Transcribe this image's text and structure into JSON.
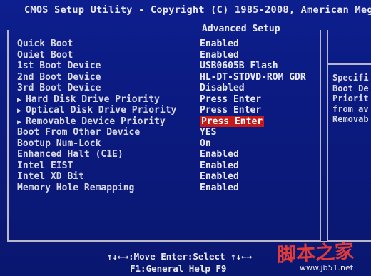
{
  "header": {
    "title": "CMOS Setup Utility - Copyright (C) 1985-2008, American Meg",
    "subtitle": "Advanced Setup"
  },
  "settings": [
    {
      "label": "Quick Boot",
      "value": "Enabled",
      "submenu": false,
      "selected": false
    },
    {
      "label": "Quiet Boot",
      "value": "Enabled",
      "submenu": false,
      "selected": false
    },
    {
      "label": "1st Boot Device",
      "value": "USB0605B Flash",
      "submenu": false,
      "selected": false
    },
    {
      "label": "2nd Boot Device",
      "value": "HL-DT-STDVD-ROM GDR",
      "submenu": false,
      "selected": false
    },
    {
      "label": "3rd Boot Device",
      "value": "Disabled",
      "submenu": false,
      "selected": false
    },
    {
      "label": "Hard Disk Drive Priority",
      "value": "Press Enter",
      "submenu": true,
      "selected": false
    },
    {
      "label": "Optical Disk Drive Priority",
      "value": "Press Enter",
      "submenu": true,
      "selected": false
    },
    {
      "label": "Removable Device Priority",
      "value": "Press Enter",
      "submenu": true,
      "selected": true
    },
    {
      "label": "Boot From Other Device",
      "value": "YES",
      "submenu": false,
      "selected": false
    },
    {
      "label": "Bootup Num-Lock",
      "value": "On",
      "submenu": false,
      "selected": false
    },
    {
      "label": "Enhanced Halt (C1E)",
      "value": "Enabled",
      "submenu": false,
      "selected": false
    },
    {
      "label": "Intel EIST",
      "value": "Enabled",
      "submenu": false,
      "selected": false
    },
    {
      "label": "Intel XD Bit",
      "value": "Enabled",
      "submenu": false,
      "selected": false
    },
    {
      "label": "Memory Hole Remapping",
      "value": "Enabled",
      "submenu": false,
      "selected": false
    }
  ],
  "help": {
    "text": "Specifi\nBoot De\nPriorit\nfrom av\nRemovab"
  },
  "footer": {
    "nav": "↑↓←→:Move  Enter:Select  ↑↓←→",
    "help": "F1:General Help        F9"
  },
  "watermark": {
    "text": "脚本之家",
    "url": "www.jb51.net"
  },
  "colors": {
    "background": "#0b1a80",
    "highlight": "#c41a1a",
    "watermark": "#e03a3a"
  }
}
